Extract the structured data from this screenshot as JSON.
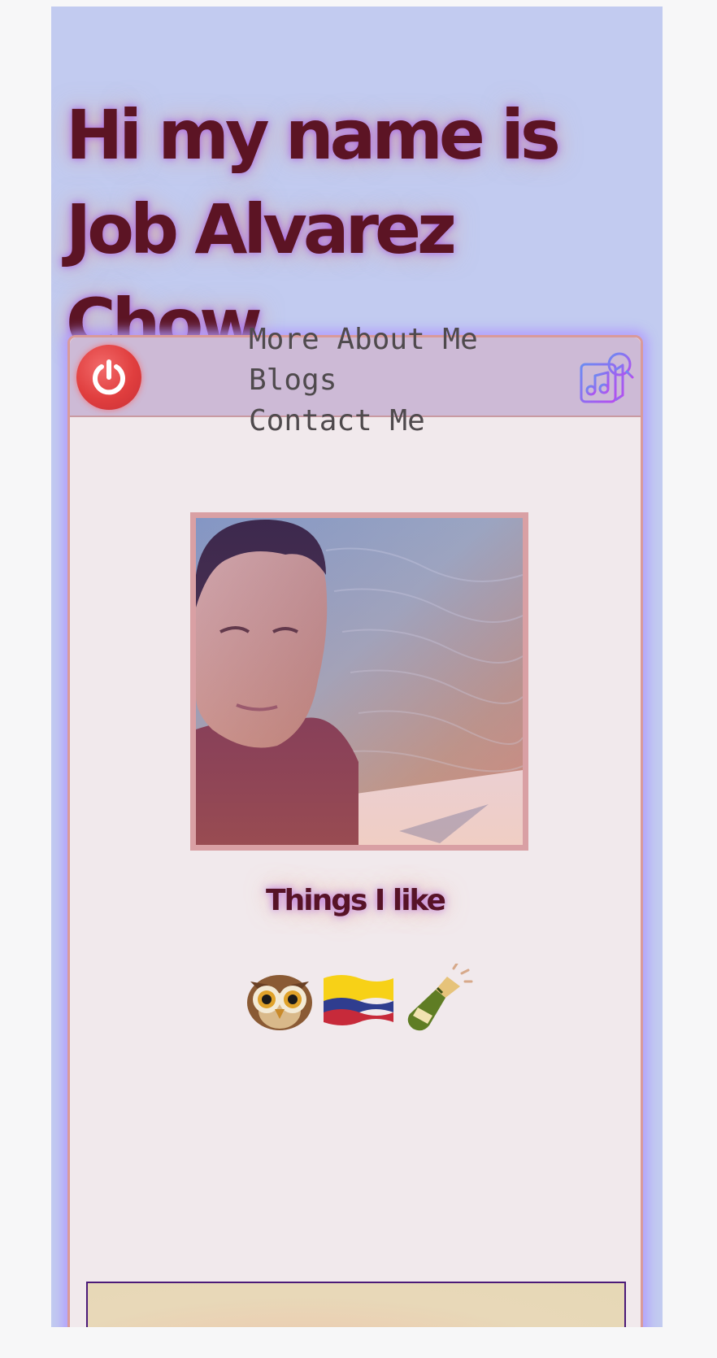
{
  "header": {
    "title": "Hi my name is Job Alvarez Chow"
  },
  "window": {
    "power_icon": "power-icon",
    "music_icon": "music-player-icon",
    "nav": [
      {
        "label": "More About Me"
      },
      {
        "label": "Blogs"
      },
      {
        "label": "Contact Me"
      }
    ]
  },
  "profile": {
    "photo_description_icon": "profile-photo"
  },
  "likes": {
    "heading": "Things I like",
    "items": [
      {
        "icon": "owl-icon"
      },
      {
        "icon": "colombia-flag-icon"
      },
      {
        "icon": "champagne-bottle-icon"
      }
    ]
  },
  "colors": {
    "page_background": "#c2cbf0",
    "title_text": "#5c1424",
    "window_background": "#f1e9ec",
    "titlebar": "#cdbad6",
    "window_border": "#d99a9a",
    "glow": "#af96ff",
    "power_button": "#e03e3e",
    "nav_text": "#4f4a4d"
  }
}
